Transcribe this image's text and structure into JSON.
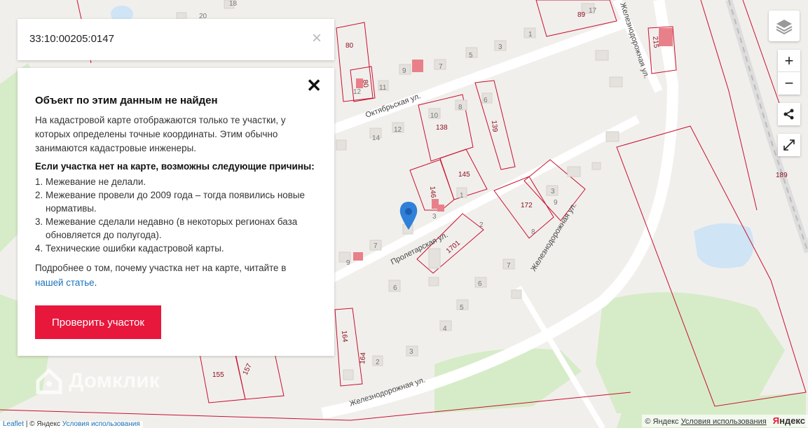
{
  "search": {
    "value": "33:10:00205:0147",
    "close_icon": "×"
  },
  "panel": {
    "close_icon": "✕",
    "title": "Объект по этим данным не найден",
    "description": "На кадастровой карте отображаются только те участки, у которых определены точные координаты. Этим обычно занимаются кадастровые инженеры.",
    "reasons_title": "Если участка нет на карте, возможны следующие причины:",
    "reasons": [
      {
        "num": "1.",
        "text": "Межевание не делали."
      },
      {
        "num": "2.",
        "text": "Межевание провели до 2009 года – тогда появились новые нормативы."
      },
      {
        "num": "3.",
        "text": "Межевание сделали недавно (в некоторых регионах база обновляется до полугода)."
      },
      {
        "num": "4.",
        "text": "Технические ошибки кадастровой карты."
      }
    ],
    "more_prefix": "Подробнее о том, почему участка нет на карте, читайте в",
    "more_link": "нашей статье",
    "more_suffix": ".",
    "button_label": "Проверить участок"
  },
  "controls": {
    "zoom_in": "+",
    "zoom_out": "−"
  },
  "watermark": "Домклик",
  "attribution_left": {
    "leaflet": "Leaflet",
    "sep": "|",
    "copyright": "© Яндекс",
    "terms": "Условия использования"
  },
  "attribution_right": {
    "copyright": "© Яндекс",
    "terms": "Условия использования",
    "logo_y": "Я",
    "logo_rest": "ндекс"
  },
  "colors": {
    "accent": "#e8173c",
    "link": "#1a73b9",
    "parcel": "#c8102e",
    "green": "#d6ecc8",
    "water": "#cfe4f5"
  },
  "map": {
    "streets": [
      "Октябрьская ул.",
      "Пролетарская ул.",
      "Железнодорожная ул.",
      "Железнодорожная ул.",
      "Железнодорожная ул."
    ],
    "parcels": [
      "80",
      "89",
      "138",
      "139",
      "145",
      "146",
      "172",
      "1701",
      "164",
      "164",
      "155",
      "157",
      "189",
      "215",
      "80"
    ],
    "houses": [
      "20",
      "18",
      "17",
      "1",
      "3",
      "5",
      "7",
      "9",
      "11",
      "12",
      "12",
      "14",
      "10",
      "8",
      "6",
      "3",
      "1",
      "3",
      "9",
      "7",
      "9",
      "2",
      "7",
      "6",
      "6",
      "5",
      "4",
      "3",
      "2",
      "8"
    ]
  }
}
